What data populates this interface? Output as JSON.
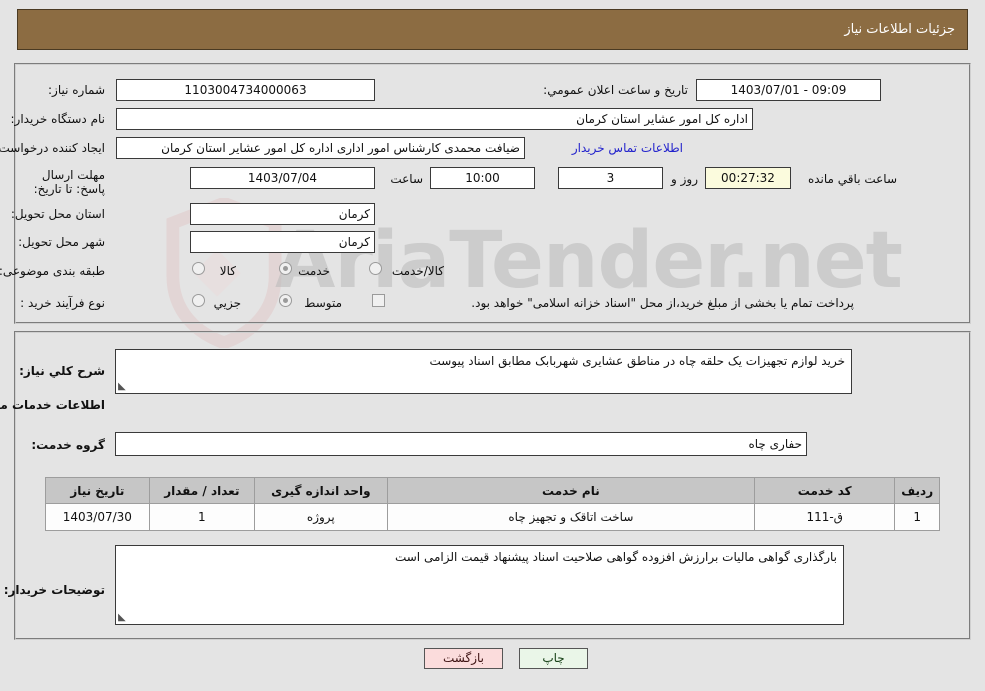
{
  "header": {
    "title": "جزئیات اطلاعات نیاز"
  },
  "top_section": {
    "need_number": {
      "label": "شماره نیاز:",
      "value": "1103004734000063"
    },
    "public_announce": {
      "label": "تاریخ و ساعت اعلان عمومي:",
      "value": "09:09 - 1403/07/01"
    },
    "buyer_org": {
      "label": "نام دستگاه خریدار:",
      "value": "اداره کل امور عشایر استان کرمان"
    },
    "requester": {
      "label": "ایجاد کننده درخواست:",
      "value": "ضیافت محمدی کارشناس امور اداری اداره کل امور عشایر استان کرمان"
    },
    "contact_link": "اطلاعات تماس خریدار",
    "deadline": {
      "label": "مهلت ارسال پاسخ: تا تاریخ:",
      "date": "1403/07/04",
      "time_label": "ساعت",
      "time": "10:00",
      "days": "3",
      "days_label": "روز و",
      "countdown": "00:27:32",
      "countdown_label": "ساعت باقي مانده"
    },
    "delivery_province": {
      "label": "استان محل تحویل:",
      "value": "کرمان"
    },
    "delivery_city": {
      "label": "شهر محل تحویل:",
      "value": "کرمان"
    },
    "subject_class": {
      "label": "طبقه بندی موضوعی:",
      "options": [
        {
          "label": "کالا",
          "selected": false
        },
        {
          "label": "خدمت",
          "selected": true
        },
        {
          "label": "کالا/خدمت",
          "selected": false
        }
      ]
    },
    "purchase_process": {
      "label": "نوع فرآیند خرید :",
      "options": [
        {
          "label": "جزیي",
          "selected": false
        },
        {
          "label": "متوسط",
          "selected": true
        }
      ],
      "treasury_checkbox": {
        "checked": false,
        "text": "پرداخت تمام یا بخشی از مبلغ خرید،از محل \"اسناد خزانه اسلامی\" خواهد بود."
      }
    }
  },
  "description_section": {
    "general_desc": {
      "label": "شرح کلي نیاز:",
      "value": "خرید لوازم تجهیزات یک حلقه چاه در مناطق عشایری شهربابک مطابق اسناد پیوست"
    },
    "services_heading": "اطلاعات خدمات مورد نیاز",
    "service_group": {
      "label": "گروه خدمت:",
      "value": "حفاری چاه"
    },
    "table": {
      "columns": [
        "ردیف",
        "کد خدمت",
        "نام خدمت",
        "واحد اندازه گیری",
        "تعداد / مقدار",
        "تاریخ نیاز"
      ],
      "rows": [
        [
          "1",
          "ق-111",
          "ساخت اتاقک و تجهیز چاه",
          "پروژه",
          "1",
          "1403/07/30"
        ]
      ]
    },
    "buyer_notes": {
      "label": "توضیحات خریدار:",
      "value": "بارگذاری گواهی مالیات برارزش افزوده گواهی صلاحیت اسناد پیشنهاد قیمت الزامی است"
    }
  },
  "footer": {
    "print_button": "چاپ",
    "back_button": "بازگشت"
  },
  "watermark": {
    "text": "AriaTender.net"
  },
  "colors": {
    "header_bg": "#8c6c42",
    "page_bg": "#e4e4e4",
    "link": "#2222cc",
    "countdown_bg": "#fbfbdd",
    "table_header_bg": "#c6c6c6",
    "print_button_bg": "#eaf6e8",
    "back_button_bg": "#fbdcdc"
  }
}
